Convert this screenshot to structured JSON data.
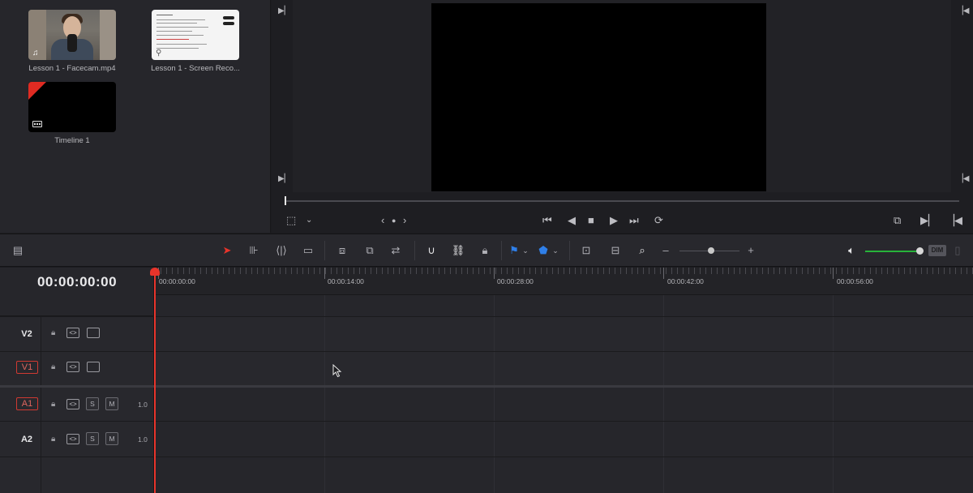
{
  "media_pool": {
    "clips": [
      {
        "label": "Lesson 1 - Facecam.mp4",
        "type_icon": "music-note-icon"
      },
      {
        "label": "Lesson 1 - Screen Reco...",
        "type_icon": "document-thumbnail"
      },
      {
        "label": "Timeline 1",
        "type_icon": "timeline-icon"
      }
    ]
  },
  "viewer": {
    "transport_icons": [
      "jump-to-start-icon",
      "reverse-play-icon",
      "stop-icon",
      "play-icon",
      "jump-to-end-icon",
      "loop-icon"
    ],
    "nav": {
      "prev": "‹",
      "dot": "●",
      "next": "›"
    }
  },
  "toolbar": {
    "tools": [
      "selection-arrow-icon",
      "trim-edit-icon",
      "dynamic-trim-icon",
      "blade-icon",
      "insert-clip-icon",
      "overwrite-clip-icon",
      "replace-clip-icon",
      "snapping-icon",
      "linked-selection-icon",
      "position-lock-icon",
      "flag-icon",
      "marker-icon",
      "zoom-full-icon",
      "zoom-detail-icon",
      "zoom-custom-icon"
    ],
    "zoom_minus": "–",
    "zoom_plus": "+",
    "dim_label": "DIM",
    "accent_selection": "#e8342b",
    "flag_color": "#2f7fe8",
    "volume_color": "#27b33a",
    "volume_level": 0.95
  },
  "timeline": {
    "timecode": "00:00:00:00",
    "ruler_labels": [
      "00:00:00:00",
      "00:00:14:00",
      "00:00:28:00",
      "00:00:42:00",
      "00:00:56:00"
    ],
    "playhead_color": "#e8342b",
    "tracks": [
      {
        "name": "V2",
        "kind": "video",
        "selected": false
      },
      {
        "name": "V1",
        "kind": "video",
        "selected": true
      },
      {
        "name": "A1",
        "kind": "audio",
        "selected": true,
        "level": "1.0"
      },
      {
        "name": "A2",
        "kind": "audio",
        "selected": false,
        "level": "1.0"
      }
    ],
    "solo_label": "S",
    "mute_label": "M"
  }
}
